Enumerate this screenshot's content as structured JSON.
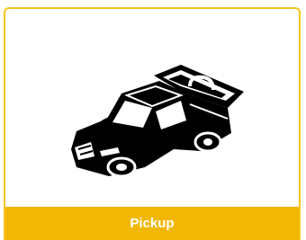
{
  "card": {
    "label": "Pickup",
    "icon": "pickup-truck-icon",
    "accent_color": "#f5c518",
    "label_bg_color": "#f2b705",
    "label_text_color": "#ffffff"
  }
}
